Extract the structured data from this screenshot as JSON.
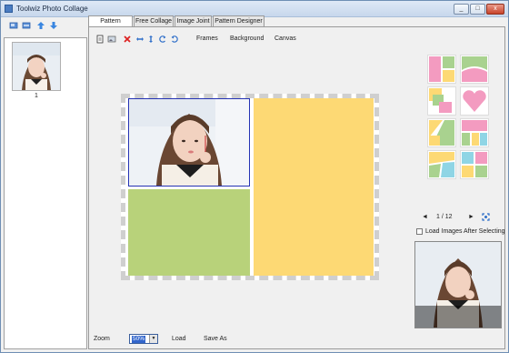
{
  "window": {
    "title": "Toolwiz Photo Collage"
  },
  "title_buttons": {
    "minimize": "_",
    "maximize": "□",
    "close": "x"
  },
  "left": {
    "icons": [
      "add-photos-icon",
      "remove-photos-icon",
      "arrow-up-icon",
      "arrow-down-icon"
    ],
    "thumbnail_label": "1"
  },
  "tabs": [
    "Pattern Collage",
    "Free Collage",
    "Image Joint",
    "Pattern Designer"
  ],
  "toolbar": {
    "icons": [
      "add-image-icon",
      "image-icon",
      "delete-icon",
      "swap-horizontal-icon",
      "swap-vertical-icon",
      "rotate-left-icon",
      "rotate-right-icon"
    ],
    "frames_label": "Frames",
    "background_label": "Background",
    "canvas_label": "Canvas"
  },
  "canvas": {
    "cells": [
      {
        "name": "photo-cell",
        "color": "#ffffff"
      },
      {
        "name": "green-cell",
        "color": "#b8d27a"
      },
      {
        "name": "yellow-cell",
        "color": "#fdd974"
      }
    ]
  },
  "templates": {
    "colors": {
      "pink": "#f39bc0",
      "yellow": "#fdd974",
      "green": "#a9d28f",
      "blue": "#8fd5e5"
    }
  },
  "pager": {
    "prev": "◄",
    "page": "1 / 12",
    "next": "►"
  },
  "load_images_label": "Load Images After Selecting",
  "load_images_checked": false,
  "bottom": {
    "zoom_label": "Zoom",
    "zoom_value": "50%",
    "load_label": "Load",
    "save_as_label": "Save As"
  }
}
